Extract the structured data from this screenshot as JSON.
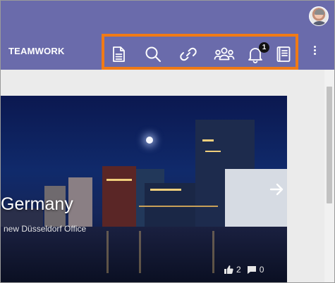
{
  "header": {
    "brand": "TEAMWORK",
    "accent_color": "#6a6bab",
    "toolbar_highlight_color": "#f07a16",
    "tools": [
      {
        "name": "document-icon"
      },
      {
        "name": "search-icon"
      },
      {
        "name": "link-icon"
      },
      {
        "name": "people-icon"
      },
      {
        "name": "bell-icon",
        "badge": "1"
      },
      {
        "name": "book-icon"
      }
    ],
    "more_menu": "more-vert-icon"
  },
  "hero": {
    "title": "Germany",
    "subtitle": "new Düsseldorf Office",
    "likes": "2",
    "comments": "0"
  }
}
